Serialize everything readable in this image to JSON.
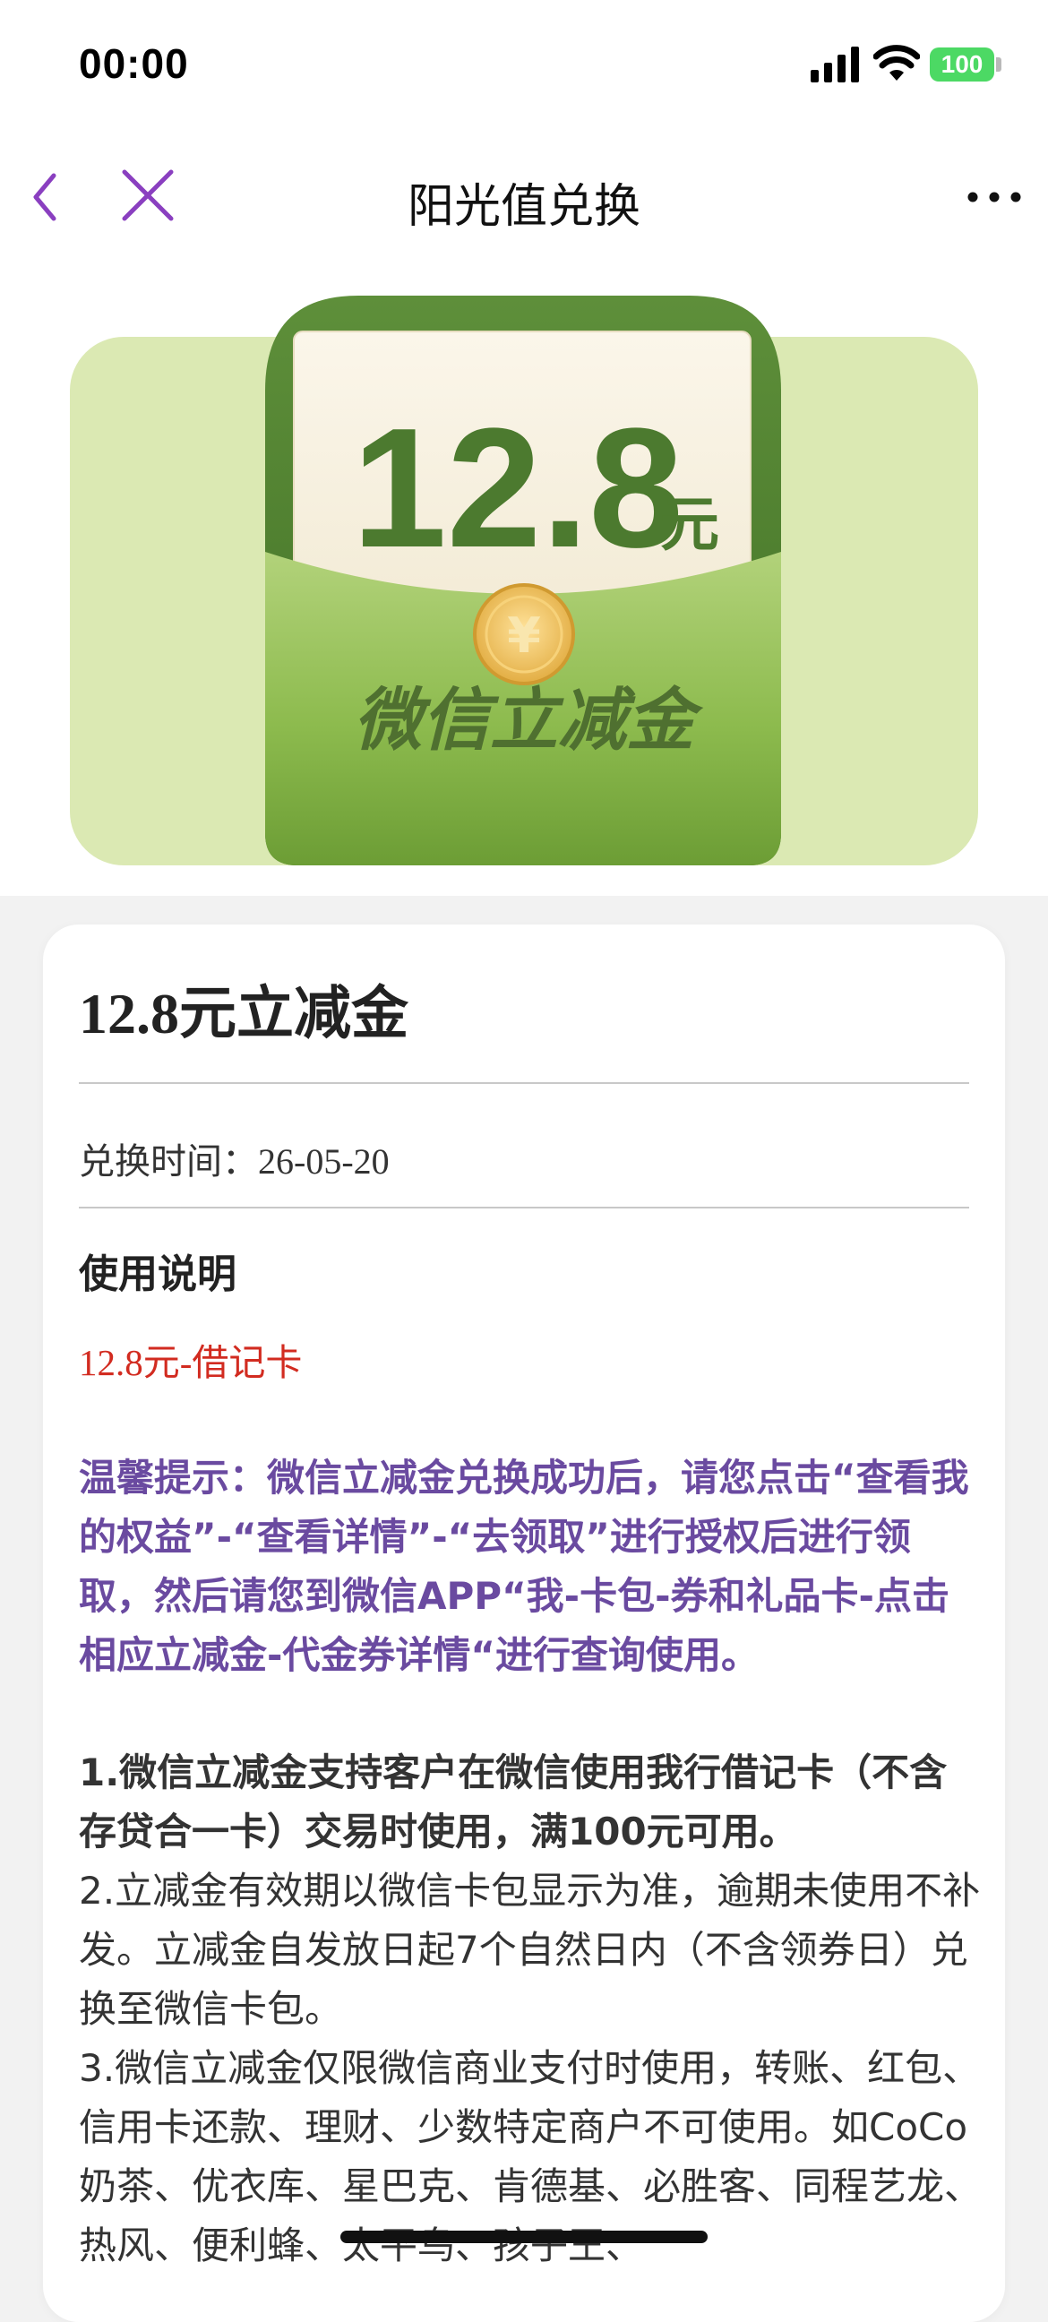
{
  "status_bar": {
    "time": "00:00",
    "battery": "100"
  },
  "nav": {
    "title": "阳光值兑换"
  },
  "banner": {
    "amount": "12.8",
    "unit": "元",
    "label": "微信立减金",
    "coin_symbol": "¥"
  },
  "card": {
    "title": "12.8元立减金",
    "exchange_time_label": "兑换时间：",
    "exchange_time_value": "26-05-20",
    "usage_title": "使用说明",
    "usage_type": "12.8元-借记卡",
    "tip": "温馨提示：微信立减金兑换成功后，请您点击“查看我的权益”-“查看详情”-“去领取”进行授权后进行领取，然后请您到微信APP“我-卡包-券和礼品卡-点击相应立减金-代金券详情“进行查询使用。",
    "rule_1": "1.微信立减金支持客户在微信使用我行借记卡（不含存贷合一卡）交易时使用，满100元可用。",
    "rule_2": "2.立减金有效期以微信卡包显示为准，逾期未使用不补发。立减金自发放日起7个自然日内（不含领券日）兑换至微信卡包。",
    "rule_3": "3.微信立减金仅限微信商业支付时使用，转账、红包、信用卡还款、理财、少数特定商户不可使用。如CoCo奶茶、优衣库、星巴克、肯德基、必胜客、同程艺龙、热风、便利蜂、太平鸟、孩子王、"
  },
  "colors": {
    "accent": "#8a3fc0",
    "tip": "#6a4aa0",
    "red": "#d22b20",
    "banner_bg": "#dbe9b3"
  }
}
